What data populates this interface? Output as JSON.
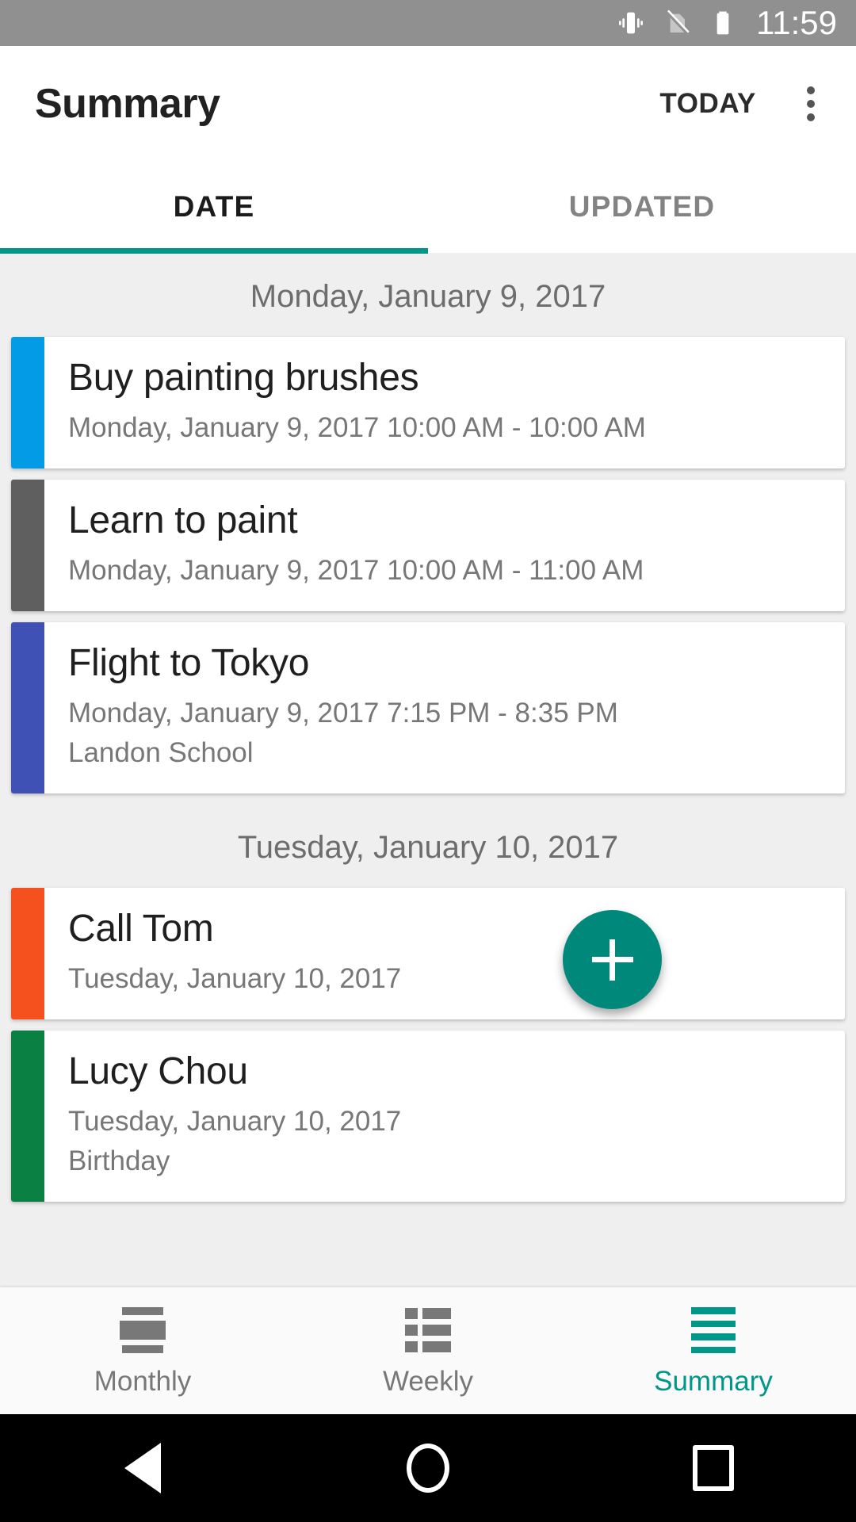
{
  "statusbar": {
    "time": "11:59",
    "icons": [
      "vibrate-icon",
      "no-sim-icon",
      "battery-icon"
    ]
  },
  "appbar": {
    "title": "Summary",
    "today_label": "TODAY",
    "overflow_icon": "more-vertical-icon"
  },
  "tabs": [
    {
      "label": "DATE",
      "active": true
    },
    {
      "label": "UPDATED",
      "active": false
    }
  ],
  "accent_color": "#009688",
  "groups": [
    {
      "date_header": "Monday, January 9, 2017",
      "events": [
        {
          "title": "Buy painting brushes",
          "subtitle": "Monday, January 9, 2017 10:00 AM - 10:00 AM",
          "detail": "",
          "color": "#039BE5"
        },
        {
          "title": "Learn to paint",
          "subtitle": "Monday, January 9, 2017 10:00 AM - 11:00 AM",
          "detail": "",
          "color": "#5F5F5F"
        },
        {
          "title": "Flight to Tokyo",
          "subtitle": "Monday, January 9, 2017 7:15 PM - 8:35 PM",
          "detail": "Landon School",
          "color": "#3F51B5"
        }
      ]
    },
    {
      "date_header": "Tuesday, January 10, 2017",
      "events": [
        {
          "title": "Call Tom",
          "subtitle": "Tuesday, January 10, 2017",
          "detail": "",
          "color": "#F4511E"
        },
        {
          "title": "Lucy Chou",
          "subtitle": "Tuesday, January 10, 2017",
          "detail": "Birthday",
          "color": "#0B8043"
        }
      ]
    }
  ],
  "fab": {
    "icon": "plus-icon",
    "color": "#00897B"
  },
  "bottom_nav": [
    {
      "label": "Monthly",
      "icon": "calendar-month-icon",
      "active": false
    },
    {
      "label": "Weekly",
      "icon": "list-week-icon",
      "active": false
    },
    {
      "label": "Summary",
      "icon": "summary-list-icon",
      "active": true
    }
  ],
  "system_nav": {
    "back": "back-triangle-icon",
    "home": "home-circle-icon",
    "recents": "recents-square-icon"
  }
}
